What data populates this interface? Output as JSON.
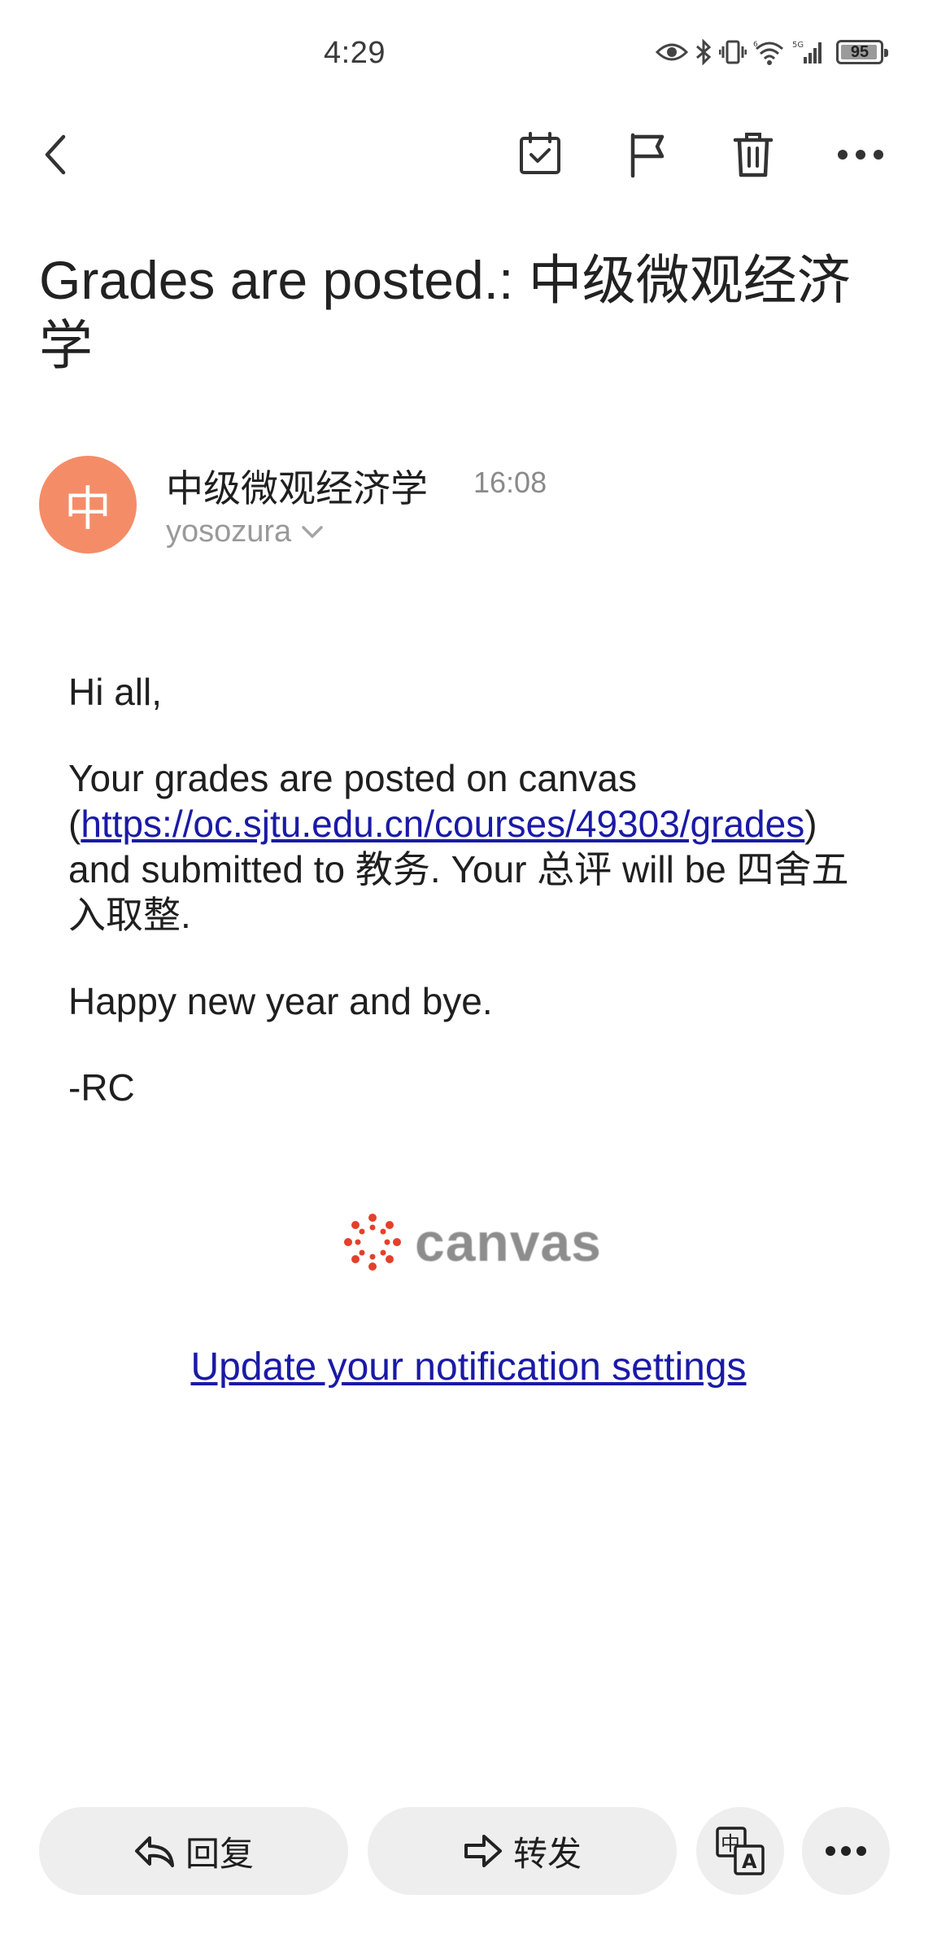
{
  "status_bar": {
    "time": "4:29",
    "network": "5G",
    "battery": "95",
    "battery_level_percent": 95
  },
  "toolbar": {
    "icons": [
      "back-chevron-icon",
      "calendar-check-icon",
      "flag-icon",
      "trash-icon",
      "more-horizontal-icon"
    ]
  },
  "email": {
    "subject": "Grades are posted.: 中级微观经济学",
    "sender": {
      "avatar_letter": "中",
      "avatar_color": "#f58c68",
      "name": "中级微观经济学",
      "time": "16:08",
      "account": "yosozura"
    },
    "body": {
      "greeting": "Hi all,",
      "para_prefix": "Your grades are posted on canvas (",
      "link": "https://oc.sjtu.edu.cn/courses/49303/grades",
      "para_suffix": ") and submitted to 教务. Your 总评 will be 四舍五入取整.",
      "closing": "Happy new year and bye.",
      "signature": "-RC"
    },
    "footer": {
      "logo_text": "canvas",
      "logo_color": "#e4402a",
      "notification_link": "Update your notification settings"
    }
  },
  "bottom_bar": {
    "reply_label": "回复",
    "forward_label": "转发",
    "translate_icon": "translate-icon",
    "more_icon": "more-horizontal-icon"
  }
}
